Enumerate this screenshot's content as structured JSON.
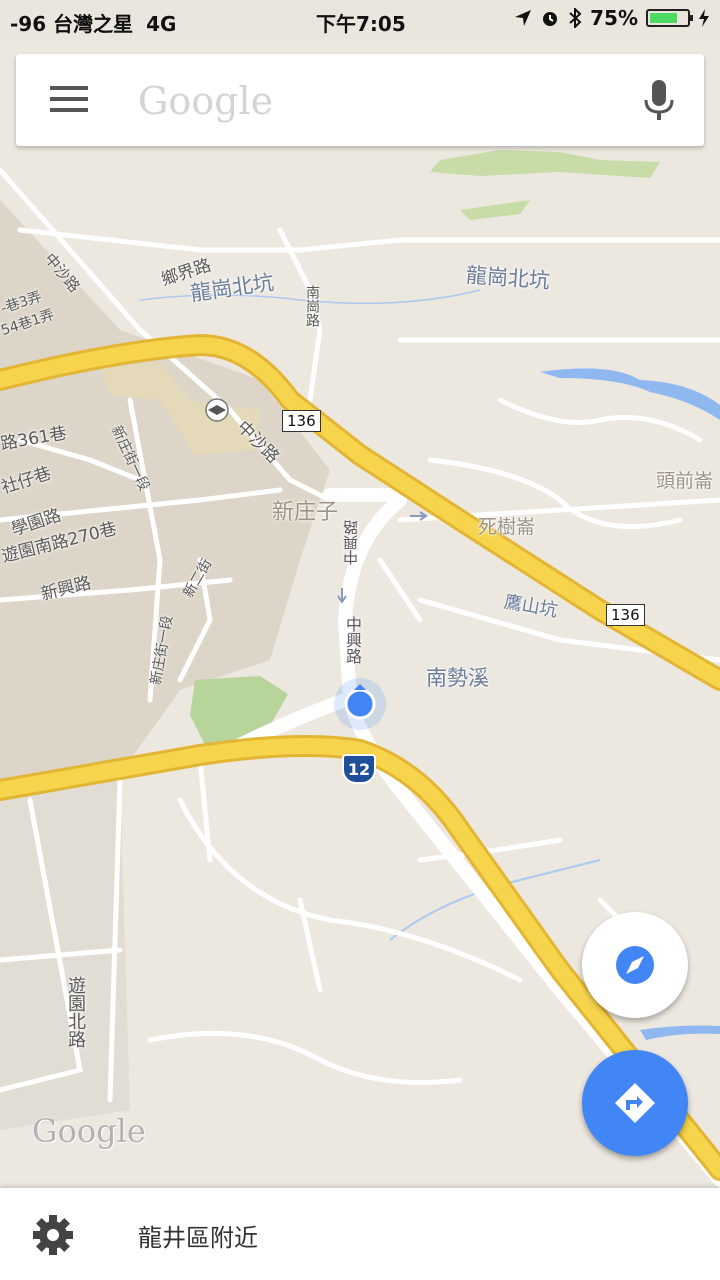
{
  "status_bar": {
    "signal": "-96",
    "carrier": "台灣之星",
    "network": "4G",
    "time": "下午7:05",
    "battery_text": "75%",
    "battery_level": 0.75,
    "battery_color": "#4cd964"
  },
  "search": {
    "placeholder": "Google",
    "menu_icon": "menu-icon",
    "mic_icon": "microphone-icon"
  },
  "map": {
    "labels": {
      "longgang_north_1": "龍崗北坑",
      "longgang_north_2": "龍崗北坑",
      "xiangjie_rd": "鄉界路",
      "nanting_rd": "南崗路",
      "zhongsha_rd_1": "中沙路",
      "zhongsha_rd_2": "中沙路",
      "xinzhuang_1": "新庄街一段",
      "xinzhuang_2": "新庄街一段",
      "lane_3": "-巷3弄",
      "lane_4": "54巷1弄",
      "lane_361": "路361巷",
      "shezai": "社仔巷",
      "xueyuan": "學園路",
      "lane_270": "遊園南路270巷",
      "xinxing": "新興路",
      "xiner": "新二街",
      "xinzhuangzi": "新庄子",
      "sishu": "死樹崙",
      "touqian": "頭前崙",
      "yingshan": "鷹山坑",
      "zhongxing_1": "中興路",
      "zhongxing_2": "中興路",
      "nanshixi": "南勢溪",
      "youyuan_north": "遊園北路"
    },
    "shields": {
      "route_136_a": "136",
      "route_136_b": "136",
      "route_12": "12"
    },
    "watermark": "Google",
    "colors": {
      "land": "#ece8e0",
      "highway": "#f6d44c",
      "highway_edge": "#e3b534",
      "road": "#ffffff",
      "urban": "#ddd5c8",
      "park": "#b7d49a",
      "water": "#8fb8f0",
      "location": "#4285f4"
    }
  },
  "fab": {
    "compass_icon": "compass-icon",
    "directions_icon": "directions-icon"
  },
  "bottom_bar": {
    "settings_icon": "gear-icon",
    "label": "龍井區附近"
  }
}
